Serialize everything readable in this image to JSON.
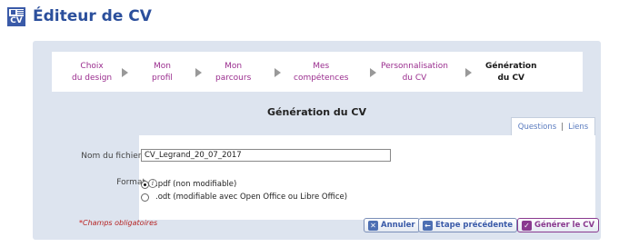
{
  "header": {
    "icon_text": "CV",
    "title": "Éditeur de CV"
  },
  "steps": [
    {
      "line1": "Choix",
      "line2": "du design",
      "active": false
    },
    {
      "line1": "Mon",
      "line2": "profil",
      "active": false
    },
    {
      "line1": "Mon",
      "line2": "parcours",
      "active": false
    },
    {
      "line1": "Mes",
      "line2": "compétences",
      "active": false
    },
    {
      "line1": "Personnalisation",
      "line2": "du CV",
      "active": false
    },
    {
      "line1": "Génération",
      "line2": "du CV",
      "active": true
    }
  ],
  "section_title": "Génération du CV",
  "tabs": {
    "questions": "Questions",
    "separator": "|",
    "liens": "Liens"
  },
  "form": {
    "filename_label": "Nom du fichier",
    "required_mark": "*",
    "filename_value": "CV_Legrand_20_07_2017",
    "format_label": "Format",
    "info_glyph": "i",
    "options": {
      "pdf": ".pdf (non modifiable)",
      "odt": ".odt (modifiable avec Open Office ou Libre Office)"
    },
    "selected": "pdf"
  },
  "required_note": "Champs obligatoires",
  "buttons": {
    "cancel": "Annuler",
    "previous": "Etape précédente",
    "generate": "Générer le CV"
  },
  "colors": {
    "brand_blue": "#2b4f9c",
    "step_link": "#9a2d8e",
    "panel_bg": "#dde4ef",
    "required": "#cc1111"
  }
}
